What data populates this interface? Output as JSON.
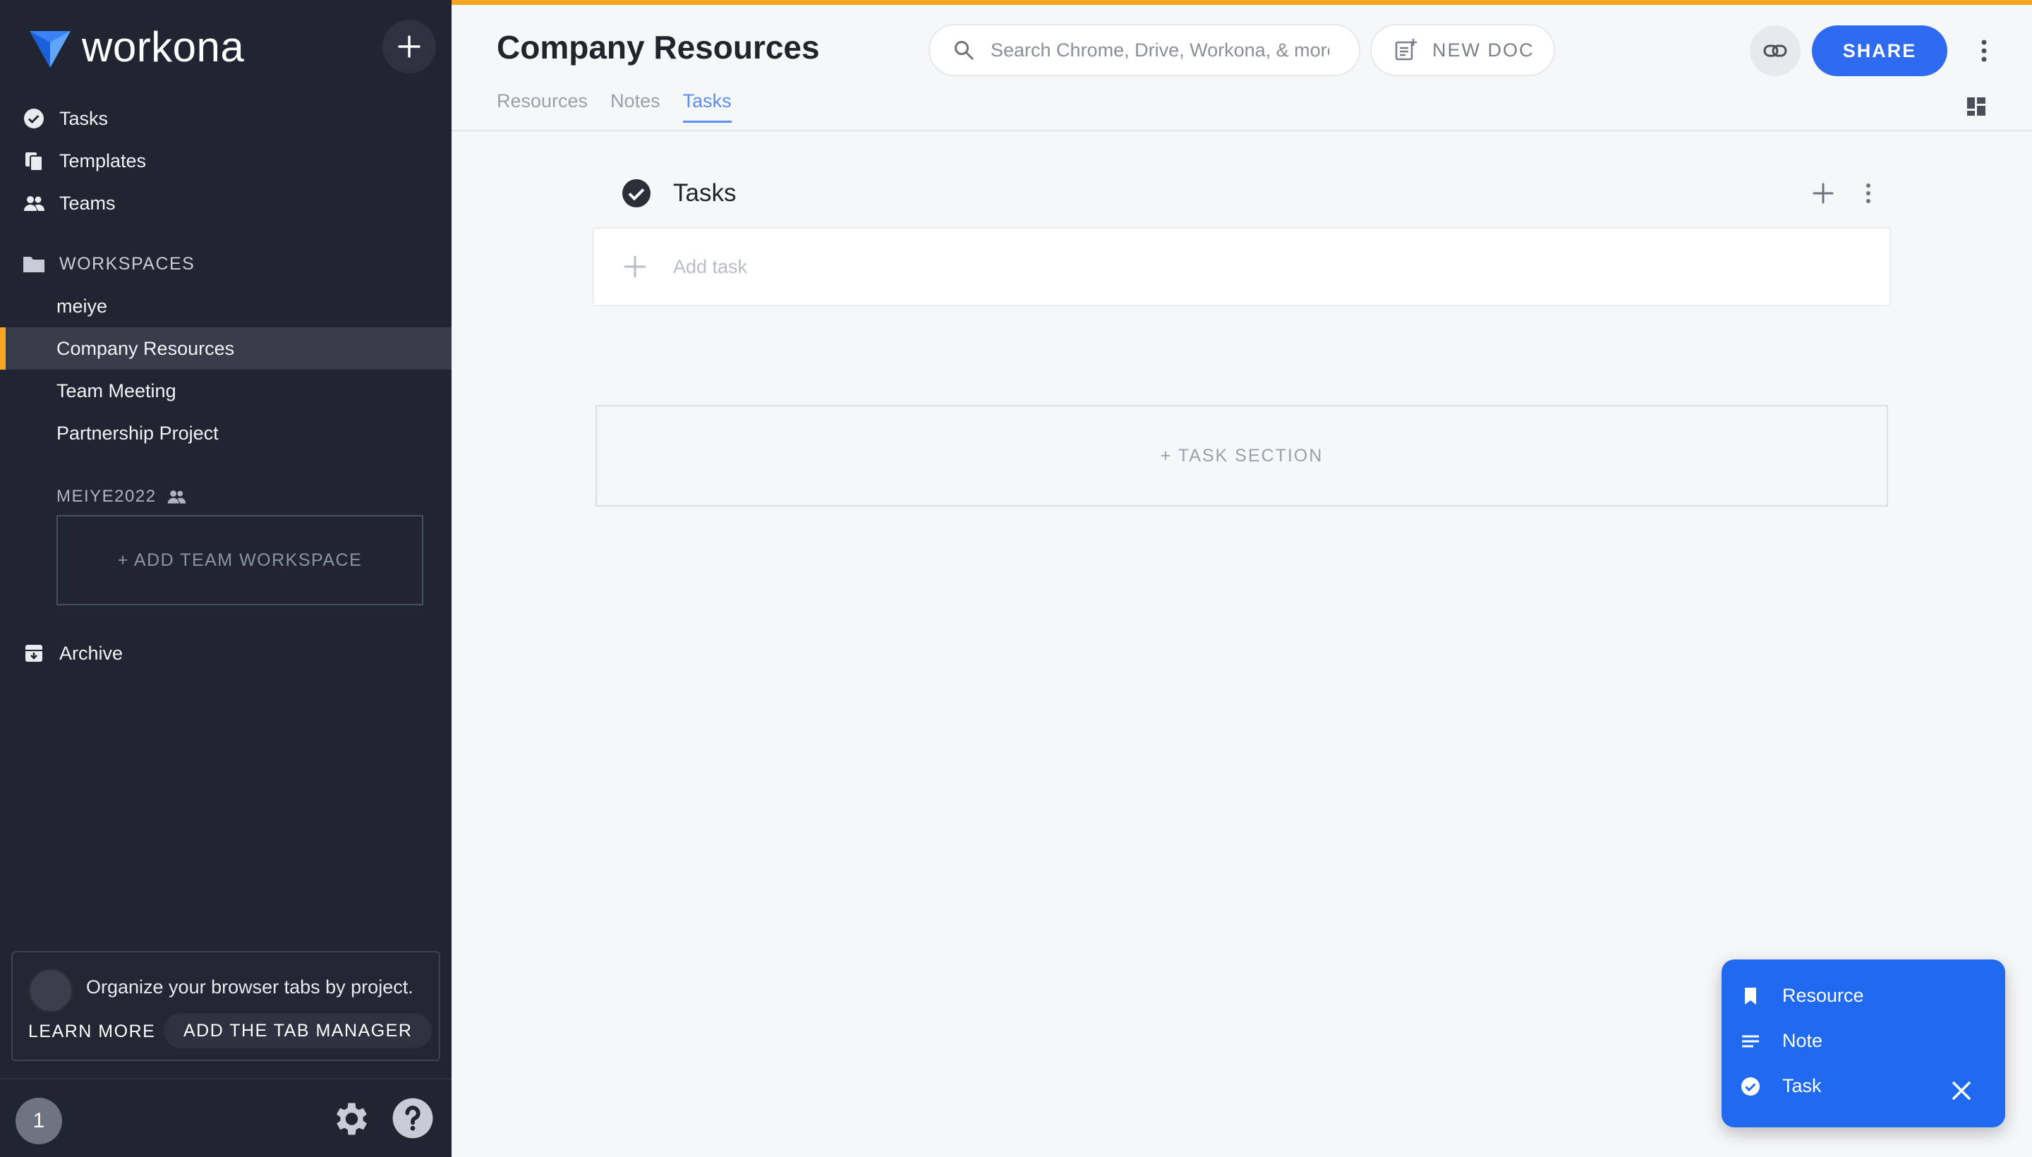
{
  "app": {
    "logo_text": "workona",
    "accent_color": "#f6a623",
    "brand_blue": "#2e6bf0"
  },
  "sidebar": {
    "nav": [
      {
        "label": "Tasks",
        "icon": "check-circle-icon"
      },
      {
        "label": "Templates",
        "icon": "copy-icon"
      },
      {
        "label": "Teams",
        "icon": "people-icon"
      }
    ],
    "workspaces_header": "WORKSPACES",
    "workspaces": [
      {
        "label": "meiye"
      },
      {
        "label": "Company Resources",
        "active": true
      },
      {
        "label": "Team Meeting"
      },
      {
        "label": "Partnership Project"
      }
    ],
    "team_name": "MEIYE2022",
    "add_team_workspace": "+ ADD TEAM WORKSPACE",
    "archive_label": "Archive",
    "promo": {
      "text": "Organize your browser tabs by project.",
      "learn_more": "LEARN MORE",
      "add_tab_manager": "ADD THE TAB MANAGER"
    },
    "footer": {
      "count": "1"
    }
  },
  "header": {
    "title": "Company Resources",
    "search_placeholder": "Search Chrome, Drive, Workona, & more",
    "new_doc_label": "NEW DOC",
    "share_label": "SHARE",
    "tabs": [
      {
        "label": "Resources"
      },
      {
        "label": "Notes"
      },
      {
        "label": "Tasks",
        "active": true
      }
    ]
  },
  "main": {
    "tasks_title": "Tasks",
    "add_task_placeholder": "Add task",
    "task_section_label": "+ TASK SECTION"
  },
  "fab_menu": {
    "items": [
      {
        "label": "Resource",
        "icon": "bookmark-icon"
      },
      {
        "label": "Note",
        "icon": "lines-icon"
      },
      {
        "label": "Task",
        "icon": "check-circle-icon"
      }
    ]
  }
}
